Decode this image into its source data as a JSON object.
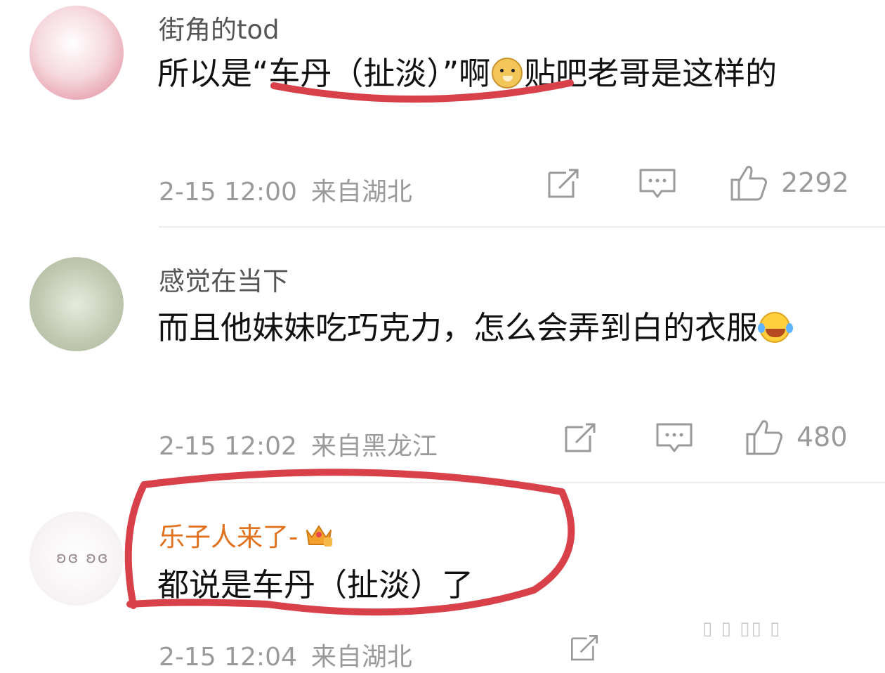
{
  "comments": [
    {
      "username": "街角的tod",
      "text_a": "所以是“车丹（扯淡）”啊",
      "text_b": "贴吧老哥是这样的",
      "emoji": "doge-emoji",
      "time": "2-15 12:00",
      "location": "来自湖北",
      "likes": "2292"
    },
    {
      "username": "感觉在当下",
      "text_a": "而且他妹妹吃巧克力，怎么会弄到白的衣服",
      "emoji": "laugh-cry-emoji",
      "time": "2-15 12:02",
      "location": "来自黑龙江",
      "likes": "480"
    },
    {
      "username": "乐子人来了-",
      "badge": "crown-icon",
      "text_a": "都说是车丹（扯淡）了",
      "time": "2-15 12:04",
      "location": "来自湖北"
    }
  ],
  "annotation_color": "#d9414a",
  "username_vip_color": "#e2711d"
}
